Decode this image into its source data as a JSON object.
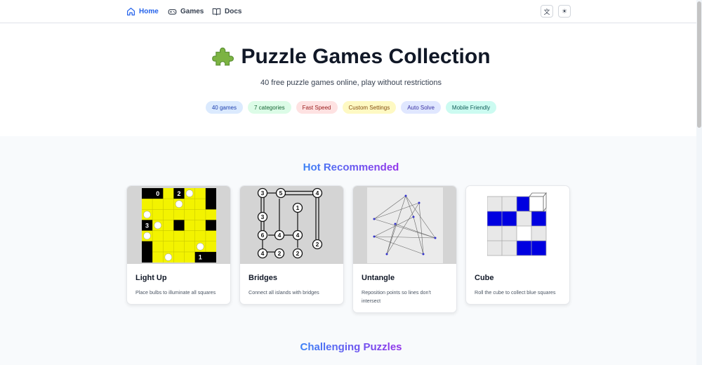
{
  "nav": {
    "home": "Home",
    "games": "Games",
    "docs": "Docs",
    "translate_glyph": "文",
    "theme_glyph": "☀"
  },
  "hero": {
    "title": "Puzzle Games Collection",
    "subtitle": "40 free puzzle games online, play without restrictions",
    "tags": [
      {
        "label": "40 games",
        "bg": "#dbeafe",
        "color": "#1e40af"
      },
      {
        "label": "7 categories",
        "bg": "#dcfce7",
        "color": "#166534"
      },
      {
        "label": "Fast Speed",
        "bg": "#fee2e2",
        "color": "#991b1b"
      },
      {
        "label": "Custom Settings",
        "bg": "#fef9c3",
        "color": "#854d0e"
      },
      {
        "label": "Auto Solve",
        "bg": "#e0e7ff",
        "color": "#3730a3"
      },
      {
        "label": "Mobile Friendly",
        "bg": "#ccfbf1",
        "color": "#115e59"
      }
    ]
  },
  "sections": {
    "hot": "Hot Recommended",
    "challenging": "Challenging Puzzles"
  },
  "cards": [
    {
      "title": "Light Up",
      "desc": "Place bulbs to illuminate all squares"
    },
    {
      "title": "Bridges",
      "desc": "Connect all islands with bridges"
    },
    {
      "title": "Untangle",
      "desc": "Reposition points so lines don't intersect"
    },
    {
      "title": "Cube",
      "desc": "Roll the cube to collect blue squares"
    }
  ],
  "thumbs": {
    "lightup_clues": [
      "0",
      "2",
      "3",
      "1"
    ],
    "bridges_nums": [
      "3",
      "5",
      "4",
      "1",
      "3",
      "6",
      "4",
      "4",
      "2",
      "4",
      "2",
      "2"
    ]
  },
  "colors": {
    "accent": "#2563eb",
    "lightup_yellow": "#f3f300",
    "cube_blue": "#0000e0"
  }
}
